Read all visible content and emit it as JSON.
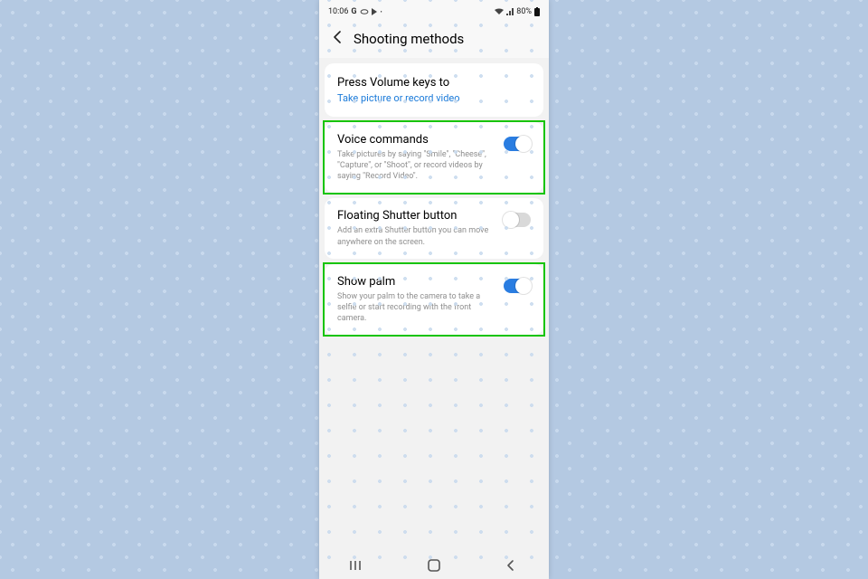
{
  "statusbar": {
    "time": "10:06",
    "battery": "80%"
  },
  "title": "Shooting methods",
  "volume": {
    "label": "Press Volume keys to",
    "value": "Take picture or record video"
  },
  "rows": [
    {
      "name": "Voice commands",
      "desc": "Take pictures by saying \"Smile\", \"Cheese\", \"Capture\", or \"Shoot\", or record videos by saying \"Record Video\".",
      "on": true,
      "hl": true
    },
    {
      "name": "Floating Shutter button",
      "desc": "Add an extra Shutter button you can move anywhere on the screen.",
      "on": false,
      "hl": false
    },
    {
      "name": "Show palm",
      "desc": "Show your palm to the camera to take a selfie or start recording with the front camera.",
      "on": true,
      "hl": true
    }
  ],
  "highlight_color": "#17c400",
  "accent": "#2a7de1"
}
